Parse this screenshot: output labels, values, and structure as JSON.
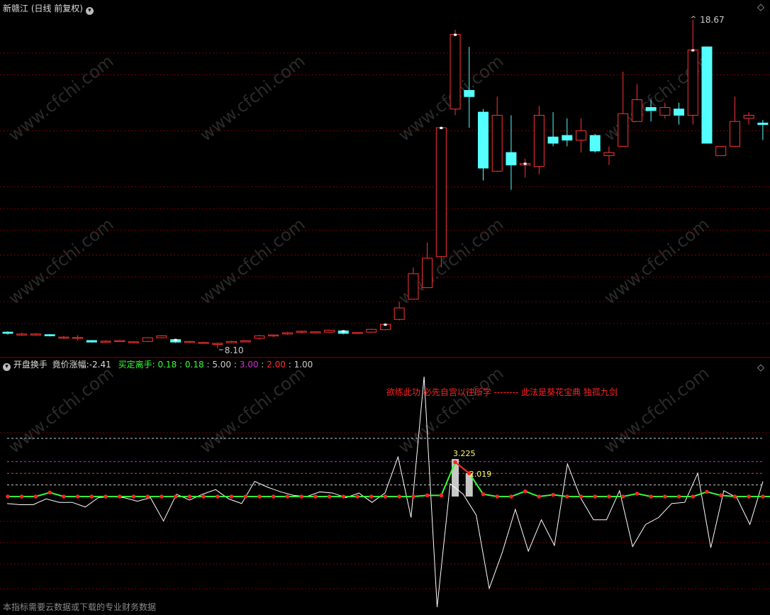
{
  "main": {
    "title": "新赣江 (日线 前复权)",
    "high_label": "18.67",
    "low_label": "8.10",
    "gridlines": [
      13.3,
      15.1,
      16.9,
      17.6,
      12.6,
      11.9,
      11.1,
      10.4,
      9.6,
      8.9
    ],
    "candles": [
      [
        8.62,
        8.58,
        8.65,
        8.54
      ],
      [
        8.55,
        8.56,
        8.6,
        8.5
      ],
      [
        8.55,
        8.56,
        8.59,
        8.52
      ],
      [
        8.54,
        8.5,
        8.56,
        8.48
      ],
      [
        8.46,
        8.46,
        8.5,
        8.4
      ],
      [
        8.45,
        8.45,
        8.52,
        8.35
      ],
      [
        8.35,
        8.3,
        8.36,
        8.28
      ],
      [
        8.3,
        8.33,
        8.36,
        8.28
      ],
      [
        8.35,
        8.35,
        8.37,
        8.32
      ],
      [
        8.3,
        8.31,
        8.33,
        8.28
      ],
      [
        8.32,
        8.44,
        8.46,
        8.3
      ],
      [
        8.44,
        8.5,
        8.52,
        8.42
      ],
      [
        8.38,
        8.3,
        8.4,
        8.27
      ],
      [
        8.32,
        8.32,
        8.34,
        8.3
      ],
      [
        8.29,
        8.29,
        8.31,
        8.27
      ],
      [
        8.24,
        8.26,
        8.28,
        8.1
      ],
      [
        8.28,
        8.32,
        8.34,
        8.26
      ],
      [
        8.33,
        8.34,
        8.36,
        8.3
      ],
      [
        8.42,
        8.5,
        8.53,
        8.38
      ],
      [
        8.5,
        8.53,
        8.55,
        8.46
      ],
      [
        8.56,
        8.6,
        8.63,
        8.53
      ],
      [
        8.62,
        8.65,
        8.67,
        8.58
      ],
      [
        8.62,
        8.63,
        8.64,
        8.6
      ],
      [
        8.62,
        8.68,
        8.7,
        8.6
      ],
      [
        8.66,
        8.58,
        8.68,
        8.55
      ],
      [
        8.6,
        8.61,
        8.62,
        8.58
      ],
      [
        8.62,
        8.71,
        8.73,
        8.6
      ],
      [
        8.7,
        8.87,
        8.9,
        8.68
      ],
      [
        9.03,
        9.4,
        9.6,
        9.0
      ],
      [
        9.68,
        10.5,
        10.7,
        9.67
      ],
      [
        10.05,
        11.0,
        11.5,
        10.05
      ],
      [
        11.05,
        15.2,
        15.25,
        10.7
      ],
      [
        15.8,
        18.2,
        18.35,
        15.6
      ],
      [
        16.4,
        16.2,
        17.8,
        15.2
      ],
      [
        15.7,
        13.9,
        15.8,
        13.5
      ],
      [
        13.8,
        15.6,
        16.2,
        13.8
      ],
      [
        14.4,
        14.0,
        15.6,
        13.2
      ],
      [
        14.0,
        14.05,
        14.2,
        13.6
      ],
      [
        13.95,
        15.6,
        15.9,
        13.7
      ],
      [
        14.9,
        14.7,
        15.7,
        14.6
      ],
      [
        14.95,
        14.8,
        15.5,
        14.6
      ],
      [
        14.8,
        15.1,
        15.5,
        14.4
      ],
      [
        14.95,
        14.45,
        15.0,
        14.4
      ],
      [
        14.3,
        14.4,
        14.6,
        14.0
      ],
      [
        14.6,
        15.65,
        17.0,
        14.6
      ],
      [
        15.4,
        16.1,
        16.6,
        15.4
      ],
      [
        15.85,
        15.75,
        16.1,
        15.4
      ],
      [
        15.6,
        15.85,
        16.0,
        15.5
      ],
      [
        15.8,
        15.6,
        16.0,
        15.3
      ],
      [
        15.6,
        17.7,
        18.67,
        15.3
      ],
      [
        17.8,
        14.7,
        17.8,
        14.7
      ],
      [
        14.3,
        14.6,
        14.6,
        14.3
      ],
      [
        14.6,
        15.4,
        16.2,
        14.6
      ],
      [
        15.5,
        15.6,
        15.7,
        15.3
      ],
      [
        15.35,
        15.3,
        15.45,
        14.8
      ],
      [
        15.4,
        15.3,
        15.6,
        15.1
      ]
    ]
  },
  "sub": {
    "title": "开盘换手",
    "p1_label": "竟价涨幅:",
    "p1_value": "-2.41",
    "p2_label": "买定离手:",
    "p2_values": [
      "0.18",
      "0.18",
      "5.00",
      "3.00",
      "2.00",
      "1.00"
    ],
    "p2_colors": [
      "#33ff33",
      "#33ff33",
      "#cccccc",
      "#cc33cc",
      "#ff3333",
      "#cccccc"
    ],
    "p2_seps": [
      ":",
      ":",
      ":",
      ":",
      ":"
    ],
    "annotation": "欲练此功 必先自宫以往所学 -------- 此法是葵花宝典 独孤九剑",
    "bar_values": [
      3.225,
      2.019
    ],
    "bar_labels": [
      "3.225",
      "2.019"
    ],
    "levels": [
      5.0,
      3.0,
      2.0,
      1.0
    ],
    "level_colors": [
      "#cccccc",
      "#cc33cc",
      "#ff3333",
      "#cccccc"
    ],
    "green": [
      0,
      0,
      0,
      0.35,
      0,
      0,
      0,
      0,
      0,
      0,
      0,
      0,
      0,
      0,
      0,
      0,
      0,
      0,
      0,
      0,
      0,
      0,
      0,
      0,
      0,
      0,
      0,
      0,
      0,
      0,
      0.1,
      0.1,
      2.95,
      2.0,
      0.2,
      0,
      0,
      0.45,
      0,
      0.15,
      0,
      0,
      0,
      0,
      0,
      0.25,
      0,
      0,
      0,
      0,
      0.4,
      0.1,
      0,
      0,
      0,
      0
    ],
    "white": [
      -0.6,
      -0.7,
      -0.7,
      -0.2,
      -0.5,
      -0.5,
      -0.9,
      -0.1,
      0,
      -0.1,
      -0.4,
      -0.1,
      -2.1,
      0.2,
      -0.3,
      0.2,
      0.6,
      -0.2,
      -0.6,
      1.3,
      0.8,
      0.4,
      0.1,
      0,
      0.4,
      0.3,
      -0.1,
      0.3,
      -0.5,
      0.3,
      3.4,
      -1.8,
      10.3,
      -9.5,
      1.1,
      0.2,
      -1.6,
      -7.9,
      -4.8,
      -1.1,
      -4.7,
      -2.0,
      -4.2,
      2.8,
      -0.1,
      -2.0,
      -2.0,
      0.5,
      -4.3,
      -2.4,
      -1.8,
      -0.6,
      -0.5,
      2.0,
      -4.4,
      0.5,
      -0.1,
      -2.4,
      1.3
    ]
  },
  "footer": "本指标需要云数据或下载的专业财务数据",
  "watermark": "www.cfchi.com",
  "colors": {
    "up": "#ff3333",
    "down": "#54ffff",
    "grid": "#7a0000",
    "separator": "#8a0000",
    "green_line": "#33ff33",
    "dot": "#ff2222"
  }
}
